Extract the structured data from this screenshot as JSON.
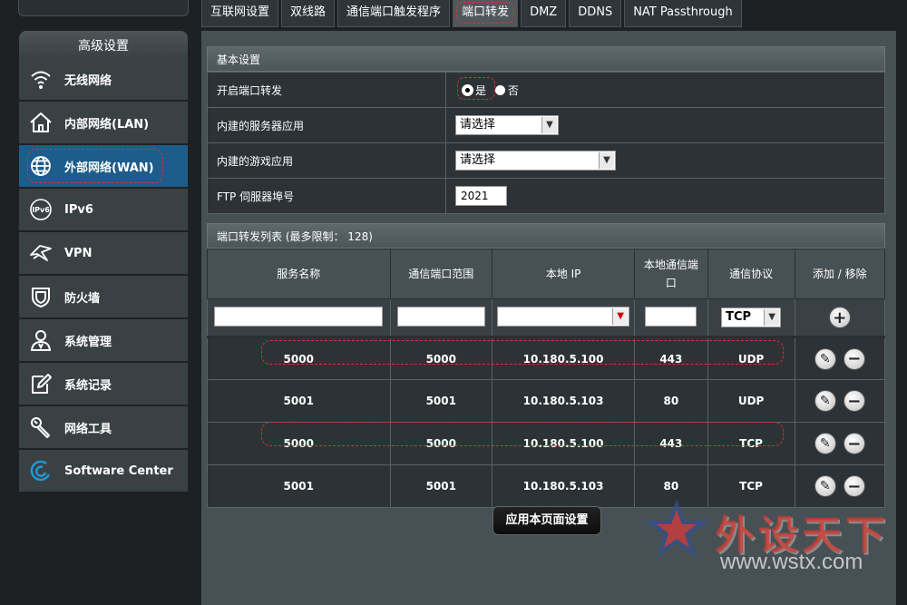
{
  "sidebar": {
    "header": "高级设置",
    "items": [
      {
        "label": "无线网络",
        "icon": "wifi-icon"
      },
      {
        "label": "内部网络(LAN)",
        "icon": "home-icon"
      },
      {
        "label": "外部网络(WAN)",
        "icon": "globe-icon"
      },
      {
        "label": "IPv6",
        "icon": "ipv6-icon"
      },
      {
        "label": "VPN",
        "icon": "vpn-icon"
      },
      {
        "label": "防火墙",
        "icon": "shield-icon"
      },
      {
        "label": "系统管理",
        "icon": "user-icon"
      },
      {
        "label": "系统记录",
        "icon": "log-icon"
      },
      {
        "label": "网络工具",
        "icon": "tools-icon"
      },
      {
        "label": "Software Center",
        "icon": "software-icon"
      }
    ]
  },
  "tabs": [
    "互联网设置",
    "双线路",
    "通信端口触发程序",
    "端口转发",
    "DMZ",
    "DDNS",
    "NAT Passthrough"
  ],
  "basic": {
    "title": "基本设置",
    "enable_label": "开启端口转发",
    "yes": "是",
    "no": "否",
    "server_app_label": "内建的服务器应用",
    "server_app_value": "请选择",
    "game_app_label": "内建的游戏应用",
    "game_app_value": "请选择",
    "ftp_label": "FTP 伺服器埠号",
    "ftp_value": "2021"
  },
  "list": {
    "title": "端口转发列表 (最多限制： 128)",
    "headers": [
      "服务名称",
      "通信端口范围",
      "本地 IP",
      "本地通信端口",
      "通信协议",
      "添加 / 移除"
    ],
    "protocol_default": "TCP",
    "rows": [
      {
        "name": "5000",
        "range": "5000",
        "ip": "10.180.5.100",
        "port": "443",
        "proto": "UDP"
      },
      {
        "name": "5001",
        "range": "5001",
        "ip": "10.180.5.103",
        "port": "80",
        "proto": "UDP"
      },
      {
        "name": "5000",
        "range": "5000",
        "ip": "10.180.5.100",
        "port": "443",
        "proto": "TCP"
      },
      {
        "name": "5001",
        "range": "5001",
        "ip": "10.180.5.103",
        "port": "80",
        "proto": "TCP"
      }
    ]
  },
  "apply_label": "应用本页面设置",
  "watermark": {
    "text": "外设天下",
    "url": "www.wstx.com"
  },
  "colors": {
    "active_item": "#1d5c8b",
    "panel": "#475054",
    "annotation": "#dd3333"
  }
}
